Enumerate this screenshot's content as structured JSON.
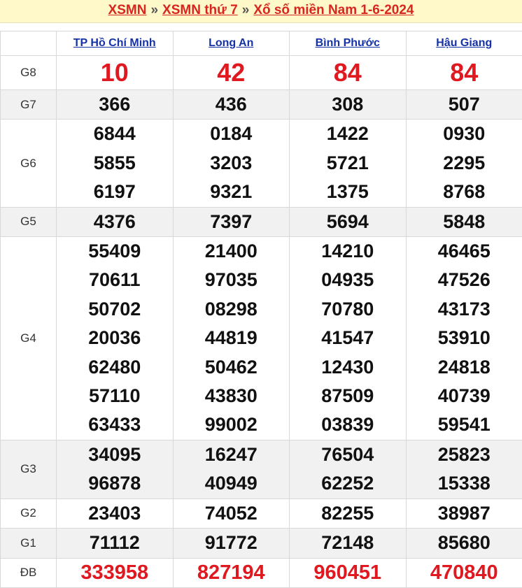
{
  "header": {
    "crumb1": "XSMN",
    "sep": "»",
    "crumb2": "XSMN thứ 7",
    "crumb3": "Xổ số miền Nam 1-6-2024"
  },
  "provinces": [
    "TP Hồ Chí Minh",
    "Long An",
    "Bình Phước",
    "Hậu Giang"
  ],
  "colors": {
    "accent_red": "#e0181f",
    "link_blue": "#1531a8",
    "title_bg": "#fff8c9"
  },
  "prizes": [
    {
      "label": "G8",
      "style": "big",
      "results": [
        [
          "10"
        ],
        [
          "42"
        ],
        [
          "84"
        ],
        [
          "84"
        ]
      ]
    },
    {
      "label": "G7",
      "style": "normal",
      "results": [
        [
          "366"
        ],
        [
          "436"
        ],
        [
          "308"
        ],
        [
          "507"
        ]
      ]
    },
    {
      "label": "G6",
      "style": "normal",
      "results": [
        [
          "6844",
          "5855",
          "6197"
        ],
        [
          "0184",
          "3203",
          "9321"
        ],
        [
          "1422",
          "5721",
          "1375"
        ],
        [
          "0930",
          "2295",
          "8768"
        ]
      ]
    },
    {
      "label": "G5",
      "style": "normal",
      "results": [
        [
          "4376"
        ],
        [
          "7397"
        ],
        [
          "5694"
        ],
        [
          "5848"
        ]
      ]
    },
    {
      "label": "G4",
      "style": "normal",
      "results": [
        [
          "55409",
          "70611",
          "50702",
          "20036",
          "62480",
          "57110",
          "63433"
        ],
        [
          "21400",
          "97035",
          "08298",
          "44819",
          "50462",
          "43830",
          "99002"
        ],
        [
          "14210",
          "04935",
          "70780",
          "41547",
          "12430",
          "87509",
          "03839"
        ],
        [
          "46465",
          "47526",
          "43173",
          "53910",
          "24818",
          "40739",
          "59541"
        ]
      ]
    },
    {
      "label": "G3",
      "style": "normal",
      "results": [
        [
          "34095",
          "96878"
        ],
        [
          "16247",
          "40949"
        ],
        [
          "76504",
          "62252"
        ],
        [
          "25823",
          "15338"
        ]
      ]
    },
    {
      "label": "G2",
      "style": "normal",
      "results": [
        [
          "23403"
        ],
        [
          "74052"
        ],
        [
          "82255"
        ],
        [
          "38987"
        ]
      ]
    },
    {
      "label": "G1",
      "style": "normal",
      "results": [
        [
          "71112"
        ],
        [
          "91772"
        ],
        [
          "72148"
        ],
        [
          "85680"
        ]
      ]
    },
    {
      "label": "ĐB",
      "style": "red",
      "results": [
        [
          "333958"
        ],
        [
          "827194"
        ],
        [
          "960451"
        ],
        [
          "470840"
        ]
      ]
    }
  ]
}
